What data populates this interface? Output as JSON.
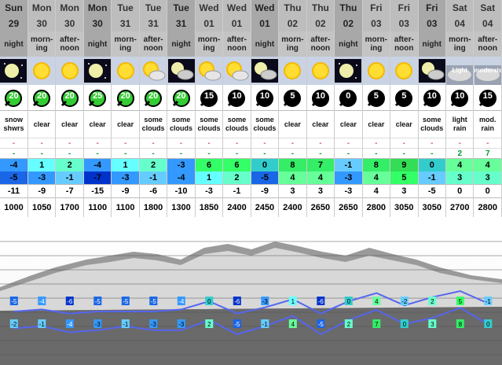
{
  "columns": [
    {
      "day": "Sun",
      "date": "29",
      "time": "night",
      "icon": "night-clear-icon",
      "wind": "20",
      "wind_color": "#33cc33",
      "desc": "snow shwrs",
      "snow_a": "-",
      "snow_b": "-",
      "tmax": "-4",
      "tmin": "-5",
      "chill": "-11",
      "freeze": "1000"
    },
    {
      "day": "Mon",
      "date": "30",
      "time": "morn-ing",
      "icon": "sun-icon",
      "wind": "20",
      "wind_color": "#33cc33",
      "desc": "clear",
      "snow_a": "-",
      "snow_b": "-",
      "tmax": "1",
      "tmin": "-3",
      "chill": "-9",
      "freeze": "1050"
    },
    {
      "day": "Mon",
      "date": "30",
      "time": "after-noon",
      "icon": "sun-icon",
      "wind": "20",
      "wind_color": "#33cc33",
      "desc": "clear",
      "snow_a": "-",
      "snow_b": "-",
      "tmax": "2",
      "tmin": "-1",
      "chill": "-7",
      "freeze": "1700"
    },
    {
      "day": "Mon",
      "date": "30",
      "time": "night",
      "icon": "night-clear-icon",
      "wind": "25",
      "wind_color": "#33cc33",
      "desc": "clear",
      "snow_a": "-",
      "snow_b": "-",
      "tmax": "-4",
      "tmin": "-7",
      "chill": "-15",
      "freeze": "1100"
    },
    {
      "day": "Tue",
      "date": "31",
      "time": "morn-ing",
      "icon": "sun-icon",
      "wind": "20",
      "wind_color": "#33cc33",
      "desc": "clear",
      "snow_a": "-",
      "snow_b": "-",
      "tmax": "1",
      "tmin": "-3",
      "chill": "-9",
      "freeze": "1100"
    },
    {
      "day": "Tue",
      "date": "31",
      "time": "after-noon",
      "icon": "sun-cloud-icon",
      "wind": "20",
      "wind_color": "#33cc33",
      "desc": "some clouds",
      "snow_a": "-",
      "snow_b": "-",
      "tmax": "2",
      "tmin": "-1",
      "chill": "-6",
      "freeze": "1800"
    },
    {
      "day": "Tue",
      "date": "31",
      "time": "night",
      "icon": "night-cloud-icon",
      "wind": "20",
      "wind_color": "#33cc33",
      "desc": "some clouds",
      "snow_a": "-",
      "snow_b": "-",
      "tmax": "-3",
      "tmin": "-4",
      "chill": "-10",
      "freeze": "1300"
    },
    {
      "day": "Wed",
      "date": "01",
      "time": "morn-ing",
      "icon": "sun-cloud-icon",
      "wind": "15",
      "wind_color": "#000000",
      "desc": "some clouds",
      "snow_a": "-",
      "snow_b": "-",
      "tmax": "6",
      "tmin": "1",
      "chill": "-3",
      "freeze": "1850"
    },
    {
      "day": "Wed",
      "date": "01",
      "time": "after-noon",
      "icon": "sun-cloud-icon",
      "wind": "10",
      "wind_color": "#000000",
      "desc": "some clouds",
      "snow_a": "-",
      "snow_b": "-",
      "tmax": "6",
      "tmin": "2",
      "chill": "-1",
      "freeze": "2400"
    },
    {
      "day": "Wed",
      "date": "01",
      "time": "night",
      "icon": "night-cloud-icon",
      "wind": "10",
      "wind_color": "#000000",
      "desc": "some clouds",
      "snow_a": "-",
      "snow_b": "-",
      "tmax": "0",
      "tmin": "-5",
      "chill": "-9",
      "freeze": "2450"
    },
    {
      "day": "Thu",
      "date": "02",
      "time": "morn-ing",
      "icon": "sun-icon",
      "wind": "5",
      "wind_color": "#000000",
      "desc": "clear",
      "snow_a": "-",
      "snow_b": "-",
      "tmax": "8",
      "tmin": "4",
      "chill": "3",
      "freeze": "2400"
    },
    {
      "day": "Thu",
      "date": "02",
      "time": "after-noon",
      "icon": "sun-icon",
      "wind": "10",
      "wind_color": "#000000",
      "desc": "clear",
      "snow_a": "-",
      "snow_b": "-",
      "tmax": "7",
      "tmin": "4",
      "chill": "3",
      "freeze": "2650"
    },
    {
      "day": "Thu",
      "date": "02",
      "time": "night",
      "icon": "night-clear-icon",
      "wind": "0",
      "wind_color": "#000000",
      "desc": "clear",
      "snow_a": "-",
      "snow_b": "-",
      "tmax": "-1",
      "tmin": "-3",
      "chill": "-3",
      "freeze": "2650"
    },
    {
      "day": "Fri",
      "date": "03",
      "time": "morn-ing",
      "icon": "sun-icon",
      "wind": "5",
      "wind_color": "#000000",
      "desc": "clear",
      "snow_a": "-",
      "snow_b": "-",
      "tmax": "8",
      "tmin": "4",
      "chill": "4",
      "freeze": "2800"
    },
    {
      "day": "Fri",
      "date": "03",
      "time": "after-noon",
      "icon": "sun-icon",
      "wind": "5",
      "wind_color": "#000000",
      "desc": "clear",
      "snow_a": "-",
      "snow_b": "-",
      "tmax": "9",
      "tmin": "5",
      "chill": "3",
      "freeze": "3050"
    },
    {
      "day": "Fri",
      "date": "03",
      "time": "night",
      "icon": "night-cloud-icon",
      "wind": "10",
      "wind_color": "#000000",
      "desc": "some clouds",
      "snow_a": "-",
      "snow_b": "-",
      "tmax": "0",
      "tmin": "-1",
      "chill": "-5",
      "freeze": "3050"
    },
    {
      "day": "Sat",
      "date": "04",
      "time": "morn-ing",
      "icon": "rain-light-icon",
      "icon_text": "Light",
      "wind": "10",
      "wind_color": "#000000",
      "desc": "light rain",
      "snow_a": "-",
      "snow_b": "2",
      "tmax": "4",
      "tmin": "3",
      "chill": "0",
      "freeze": "2700"
    },
    {
      "day": "Sat",
      "date": "04",
      "time": "after-noon",
      "icon": "rain-moderate-icon",
      "icon_text": "moderate",
      "wind": "15",
      "wind_color": "#000000",
      "desc": "mod. rain",
      "snow_a": "-",
      "snow_b": "7",
      "tmax": "4",
      "tmin": "3",
      "chill": "0",
      "freeze": "2800"
    }
  ],
  "chart_data": {
    "type": "line",
    "series": [
      {
        "values": [
          -5,
          -4,
          -6,
          -5,
          -5,
          -5,
          -4,
          0,
          -6,
          -3,
          1,
          -6,
          0,
          4,
          -2,
          2,
          5,
          -1
        ]
      },
      {
        "values": [
          -2,
          -1,
          -4,
          -3,
          -1,
          -3,
          -3,
          2,
          -5,
          -1,
          4,
          -5,
          2,
          7,
          0,
          3,
          8,
          0
        ]
      }
    ]
  },
  "colors": {
    "temp_scale": {
      "-7": "#0033cc",
      "-5": "#1a66e6",
      "-4": "#3399ff",
      "-3": "#3399ff",
      "-1": "#66ccff",
      "0": "#33cccc",
      "1": "#66ffff",
      "2": "#66ffcc",
      "3": "#66ffcc",
      "4": "#66ff99",
      "5": "#33ff66",
      "6": "#33ff66",
      "7": "#33ee66",
      "8": "#33ee66",
      "9": "#33dd55"
    }
  }
}
